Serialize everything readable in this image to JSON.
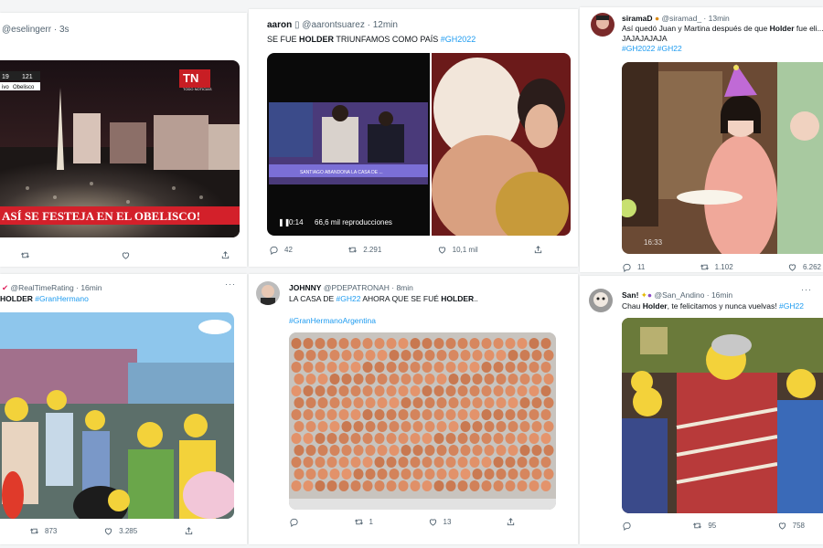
{
  "tweets": [
    {
      "user": "",
      "handle": "@eselingerr",
      "time": "· 3s",
      "text": "",
      "media": {
        "channel_logo": "TN",
        "channel_sub": "TODO NOTICIAS",
        "score_a": "19",
        "score_b": "121",
        "live_tag": "ivo",
        "location": "Obelisco",
        "banner": "ASÍ SE FESTEJA EN EL OBELISCO!"
      },
      "replies": "",
      "retweets": "",
      "likes": ""
    },
    {
      "user": "aaron",
      "handle": "@aarontsuarez",
      "time": "· 12min",
      "text_plain": "SE FUE ",
      "text_bold": "HOLDER",
      "text_rest": " TRIUNFAMOS COMO PAÍS ",
      "hashtag": "#GH2022",
      "media": {
        "video_time": "0:14",
        "video_views": "66,6 mil reproducciones",
        "video_caption": "SANTIAGO ABANDONA LA CASA DE ..."
      },
      "replies": "42",
      "retweets": "2.291",
      "likes": "10,1 mil"
    },
    {
      "user": "siramaD",
      "handle": "@siramad_",
      "time": "· 13min",
      "text_line1_a": "Así quedó Juan y Martina después de que ",
      "text_line1_bold": "Holder",
      "text_line1_b": " fue eli...",
      "text_line2": "JAJAJAJAJA",
      "hashtags": "#GH2022 #GH22",
      "media": {
        "timestamp": "16:33"
      },
      "replies": "11",
      "retweets": "1.102",
      "likes": "6.262"
    },
    {
      "user": "",
      "handle": "@RealTimeRating",
      "time": "· 16min",
      "text_bold": "HOLDER",
      "hashtag": "#GranHermano",
      "replies": "",
      "retweets": "873",
      "likes": "3.285"
    },
    {
      "user": "JOHNNY",
      "handle": "@PDEPATRONAH",
      "time": "· 8min",
      "text_a": "LA CASA DE ",
      "hashtag1": "#GH22",
      "text_b": " AHORA QUE SE FUÉ ",
      "text_bold": "HOLDER",
      "text_c": "..",
      "hashtag2": "#GranHermanoArgentina",
      "replies": "",
      "retweets": "1",
      "likes": "13"
    },
    {
      "user": "San!",
      "handle": "@San_Andino",
      "time": "· 16min",
      "text_a": "Chau ",
      "text_bold": "Holder",
      "text_b": ", te felicitamos y nunca vuelvas! ",
      "hashtag": "#GH22",
      "replies": "",
      "retweets": "95",
      "likes": "758"
    }
  ],
  "icons": {
    "reply": "reply-icon",
    "retweet": "retweet-icon",
    "like": "heart-icon",
    "share": "share-icon",
    "more": "more-icon"
  },
  "colors": {
    "accent": "#1d9bf0",
    "banner_red": "#d3202a",
    "text": "#0f1419",
    "muted": "#536471"
  }
}
